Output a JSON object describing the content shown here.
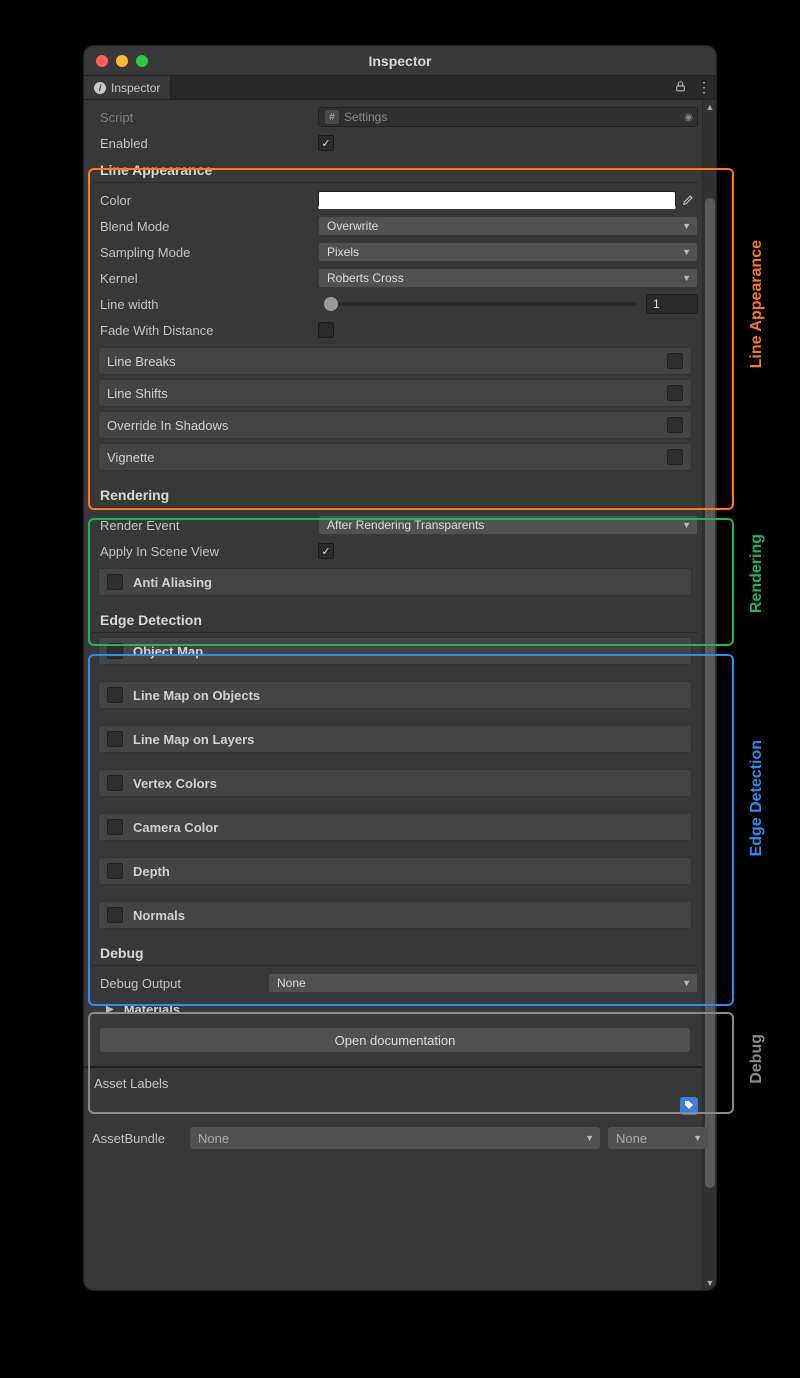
{
  "window": {
    "title": "Inspector"
  },
  "tab": {
    "label": "Inspector"
  },
  "script_row": {
    "label": "Script",
    "value": "Settings"
  },
  "enabled_row": {
    "label": "Enabled",
    "checked": true
  },
  "sections": {
    "line_appearance": {
      "title": "Line Appearance",
      "color": {
        "label": "Color",
        "value": "#ffffff"
      },
      "blend_mode": {
        "label": "Blend Mode",
        "value": "Overwrite"
      },
      "sampling_mode": {
        "label": "Sampling Mode",
        "value": "Pixels"
      },
      "kernel": {
        "label": "Kernel",
        "value": "Roberts Cross"
      },
      "line_width": {
        "label": "Line width",
        "value": "1"
      },
      "fade": {
        "label": "Fade With Distance",
        "checked": false
      },
      "foldouts": [
        {
          "label": "Line Breaks",
          "checked": false
        },
        {
          "label": "Line Shifts",
          "checked": false
        },
        {
          "label": "Override In Shadows",
          "checked": false
        },
        {
          "label": "Vignette",
          "checked": false
        }
      ]
    },
    "rendering": {
      "title": "Rendering",
      "render_event": {
        "label": "Render Event",
        "value": "After Rendering Transparents"
      },
      "apply_scene": {
        "label": "Apply In Scene View",
        "checked": true
      },
      "foldouts": [
        {
          "label": "Anti Aliasing",
          "checked": false
        }
      ]
    },
    "edge_detection": {
      "title": "Edge Detection",
      "foldouts": [
        {
          "label": "Object Map",
          "checked": false
        },
        {
          "label": "Line Map on Objects",
          "checked": false
        },
        {
          "label": "Line Map on Layers",
          "checked": false
        },
        {
          "label": "Vertex Colors",
          "checked": false
        },
        {
          "label": "Camera Color",
          "checked": false
        },
        {
          "label": "Depth",
          "checked": false
        },
        {
          "label": "Normals",
          "checked": false
        }
      ]
    },
    "debug": {
      "title": "Debug",
      "output": {
        "label": "Debug Output",
        "value": "None"
      },
      "materials": {
        "label": "Materials"
      }
    }
  },
  "docs_button": "Open documentation",
  "asset_labels": "Asset Labels",
  "asset_bundle": {
    "label": "AssetBundle",
    "main": "None",
    "sub": "None"
  },
  "annotations": {
    "line_appearance": "Line Appearance",
    "rendering": "Rendering",
    "edge_detection": "Edge Detection",
    "debug": "Debug"
  }
}
